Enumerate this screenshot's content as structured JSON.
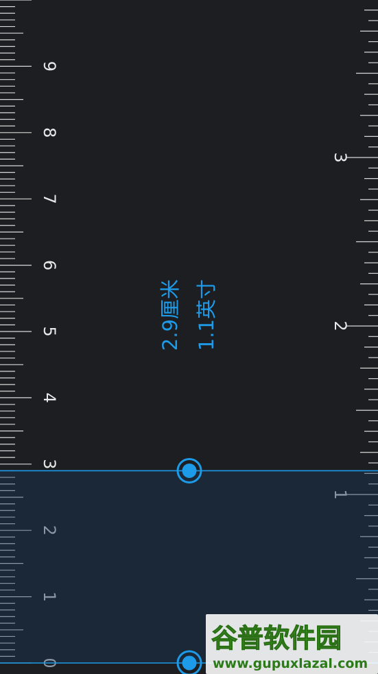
{
  "colors": {
    "background": "#1c1e22",
    "selection_fill": "#1a2838",
    "accent": "#1e9be8",
    "tick": "#d8d8d8",
    "tick_dim": "#8a96a3",
    "watermark_green": "#2a8a1e",
    "watermark_green_light": "#4fb82c"
  },
  "measurement": {
    "cm_label": "2.9厘米",
    "inch_label": "1.1英寸",
    "cm_value": 2.9,
    "inch_value": 1.1
  },
  "cm_scale": {
    "labels": [
      "0",
      "1",
      "2",
      "3",
      "4",
      "5",
      "6",
      "7",
      "8",
      "9"
    ],
    "units": "cm"
  },
  "inch_scale": {
    "labels": [
      "1",
      "2",
      "3"
    ],
    "units": "inch"
  },
  "handles": {
    "start_icon": "drag-handle-icon",
    "end_icon": "drag-handle-icon"
  },
  "watermark": {
    "brand": "谷普软件园",
    "url": "www.gupuxlazal.com"
  }
}
